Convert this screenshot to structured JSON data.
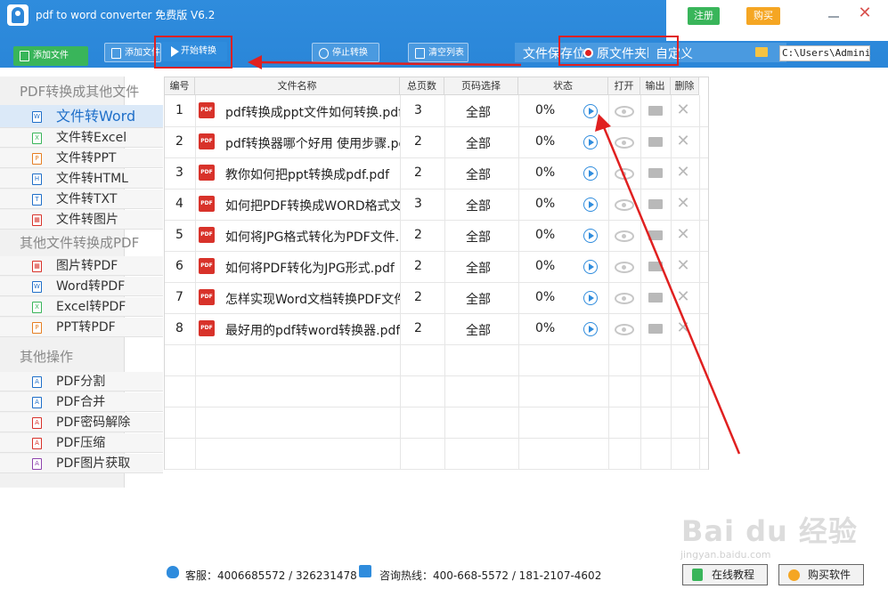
{
  "header": {
    "app_title": "pdf to word converter 免费版 V6.2",
    "register_label": "注册",
    "buy_label": "购买"
  },
  "toolbar": {
    "add_file_label": "添加文件",
    "add_folder_label": "添加文件",
    "start_label": "开始转换",
    "stop_label": "停止转换",
    "clear_label": "清空列表"
  },
  "save_location": {
    "label": "文件保存位",
    "option_source": "原文件夹",
    "option_custom": "自定义",
    "path": "C:\\Users\\Adminis"
  },
  "sidebar": {
    "sections": [
      {
        "title": "PDF转换成其他文件",
        "items": [
          "文件转Word",
          "文件转Excel",
          "文件转PPT",
          "文件转HTML",
          "文件转TXT",
          "文件转图片"
        ]
      },
      {
        "title": "其他文件转换成PDF",
        "items": [
          "图片转PDF",
          "Word转PDF",
          "Excel转PDF",
          "PPT转PDF"
        ]
      },
      {
        "title": "其他操作",
        "items": [
          "PDF分割",
          "PDF合并",
          "PDF密码解除",
          "PDF压缩",
          "PDF图片获取"
        ]
      }
    ]
  },
  "table": {
    "headers": [
      "编号",
      "文件名称",
      "总页数",
      "页码选择",
      "状态",
      "打开",
      "输出",
      "删除"
    ],
    "rows": [
      {
        "no": "1",
        "name": "pdf转换成ppt文件如何转换.pdf",
        "pages": "3",
        "range": "全部",
        "status": "0%"
      },
      {
        "no": "2",
        "name": "pdf转换器哪个好用 使用步骤.pdf",
        "pages": "2",
        "range": "全部",
        "status": "0%"
      },
      {
        "no": "3",
        "name": "教你如何把ppt转换成pdf.pdf",
        "pages": "2",
        "range": "全部",
        "status": "0%"
      },
      {
        "no": "4",
        "name": "如何把PDF转换成WORD格式文档",
        "pages": "3",
        "range": "全部",
        "status": "0%"
      },
      {
        "no": "5",
        "name": "如何将JPG格式转化为PDF文件.pd",
        "pages": "2",
        "range": "全部",
        "status": "0%"
      },
      {
        "no": "6",
        "name": "如何将PDF转化为JPG形式.pdf",
        "pages": "2",
        "range": "全部",
        "status": "0%"
      },
      {
        "no": "7",
        "name": "怎样实现Word文档转换PDF文件.p",
        "pages": "2",
        "range": "全部",
        "status": "0%"
      },
      {
        "no": "8",
        "name": "最好用的pdf转word转换器.pdf",
        "pages": "2",
        "range": "全部",
        "status": "0%"
      }
    ]
  },
  "footer": {
    "service": "客服：4006685572 / 326231478",
    "hotline": "咨询热线：400-668-5572 / 181-2107-4602",
    "tutorial_label": "在线教程",
    "buy_software_label": "购买软件"
  },
  "watermark": {
    "brand": "Bai du 经验",
    "url": "jingyan.baidu.com"
  },
  "colors": {
    "header_blue": "#2f8cdd",
    "green": "#39b55a",
    "orange": "#f5a623",
    "annotation_red": "#e02020"
  }
}
